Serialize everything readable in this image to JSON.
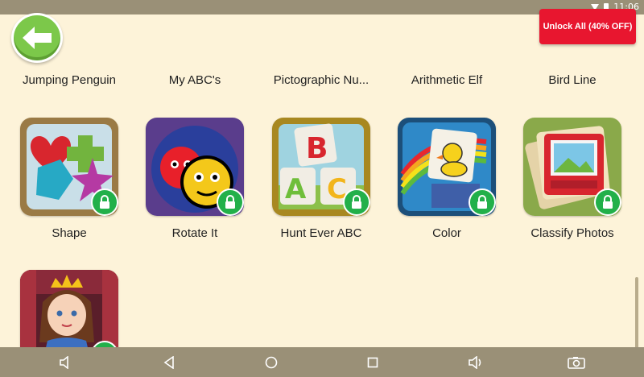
{
  "status_bar": {
    "time": "11:06"
  },
  "unlock_button": {
    "label": "Unlock All (40% OFF)"
  },
  "top_row_labels": [
    "Jumping Penguin",
    "My ABC's",
    "Pictographic Nu...",
    "Arithmetic Elf",
    "Bird Line"
  ],
  "apps": [
    {
      "label": "Shape",
      "icon": "shape-icon",
      "locked": true
    },
    {
      "label": "Rotate It",
      "icon": "rotate-it-icon",
      "locked": true
    },
    {
      "label": "Hunt Ever ABC",
      "icon": "hunt-ever-abc-icon",
      "locked": true
    },
    {
      "label": "Color",
      "icon": "color-icon",
      "locked": true
    },
    {
      "label": "Classify Photos",
      "icon": "classify-photos-icon",
      "locked": true
    },
    {
      "label": "",
      "icon": "princess-icon",
      "locked": true
    }
  ],
  "colors": {
    "background": "#fdf3d9",
    "unlock": "#e8162f",
    "back": "#7cc84a",
    "lock": "#22b04a",
    "nav": "#9a9077"
  }
}
